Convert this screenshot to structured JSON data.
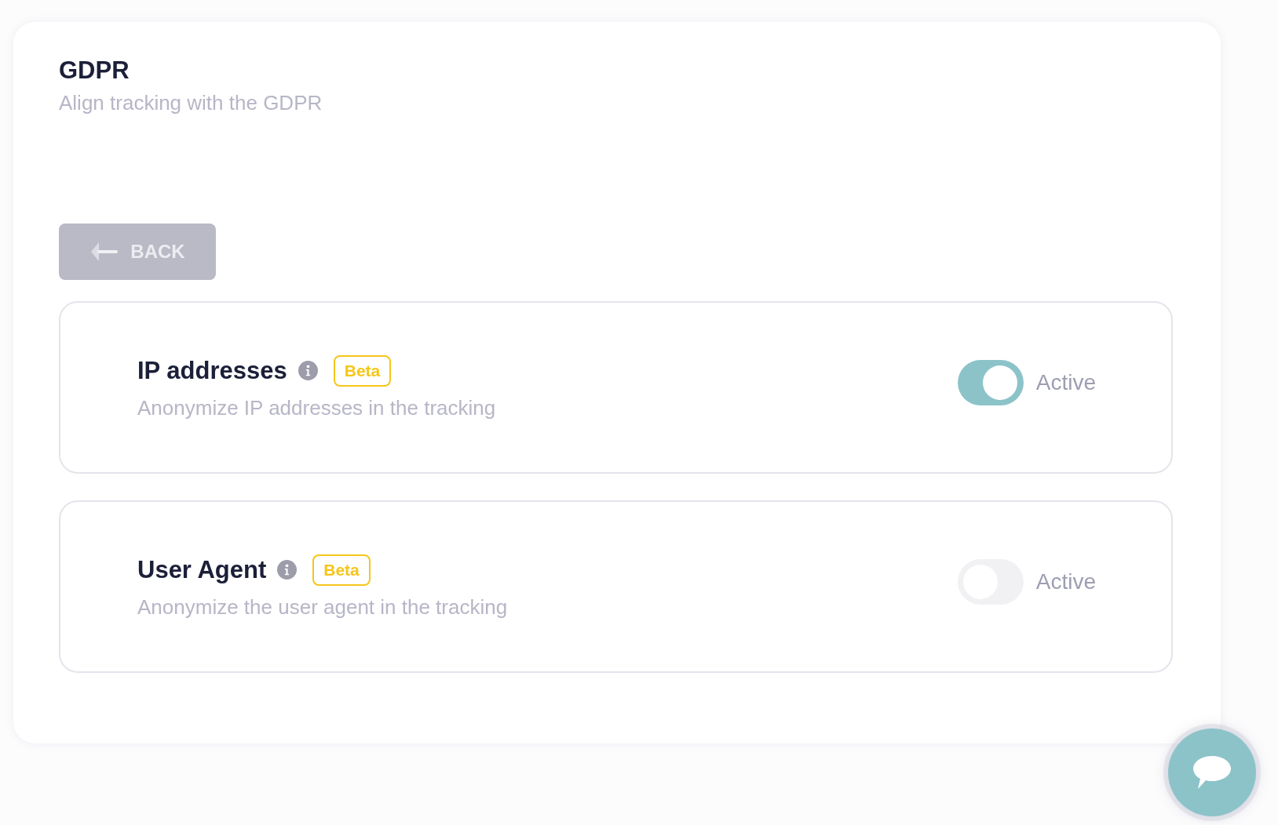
{
  "page": {
    "title": "GDPR",
    "subtitle": "Align tracking with the GDPR"
  },
  "back_button": {
    "label": "BACK"
  },
  "settings": [
    {
      "title": "IP addresses",
      "badge": "Beta",
      "description": "Anonymize IP addresses in the tracking",
      "on": true,
      "status": "Active"
    },
    {
      "title": "User Agent",
      "badge": "Beta",
      "description": "Anonymize the user agent in the tracking",
      "on": false,
      "status": "Active"
    }
  ]
}
